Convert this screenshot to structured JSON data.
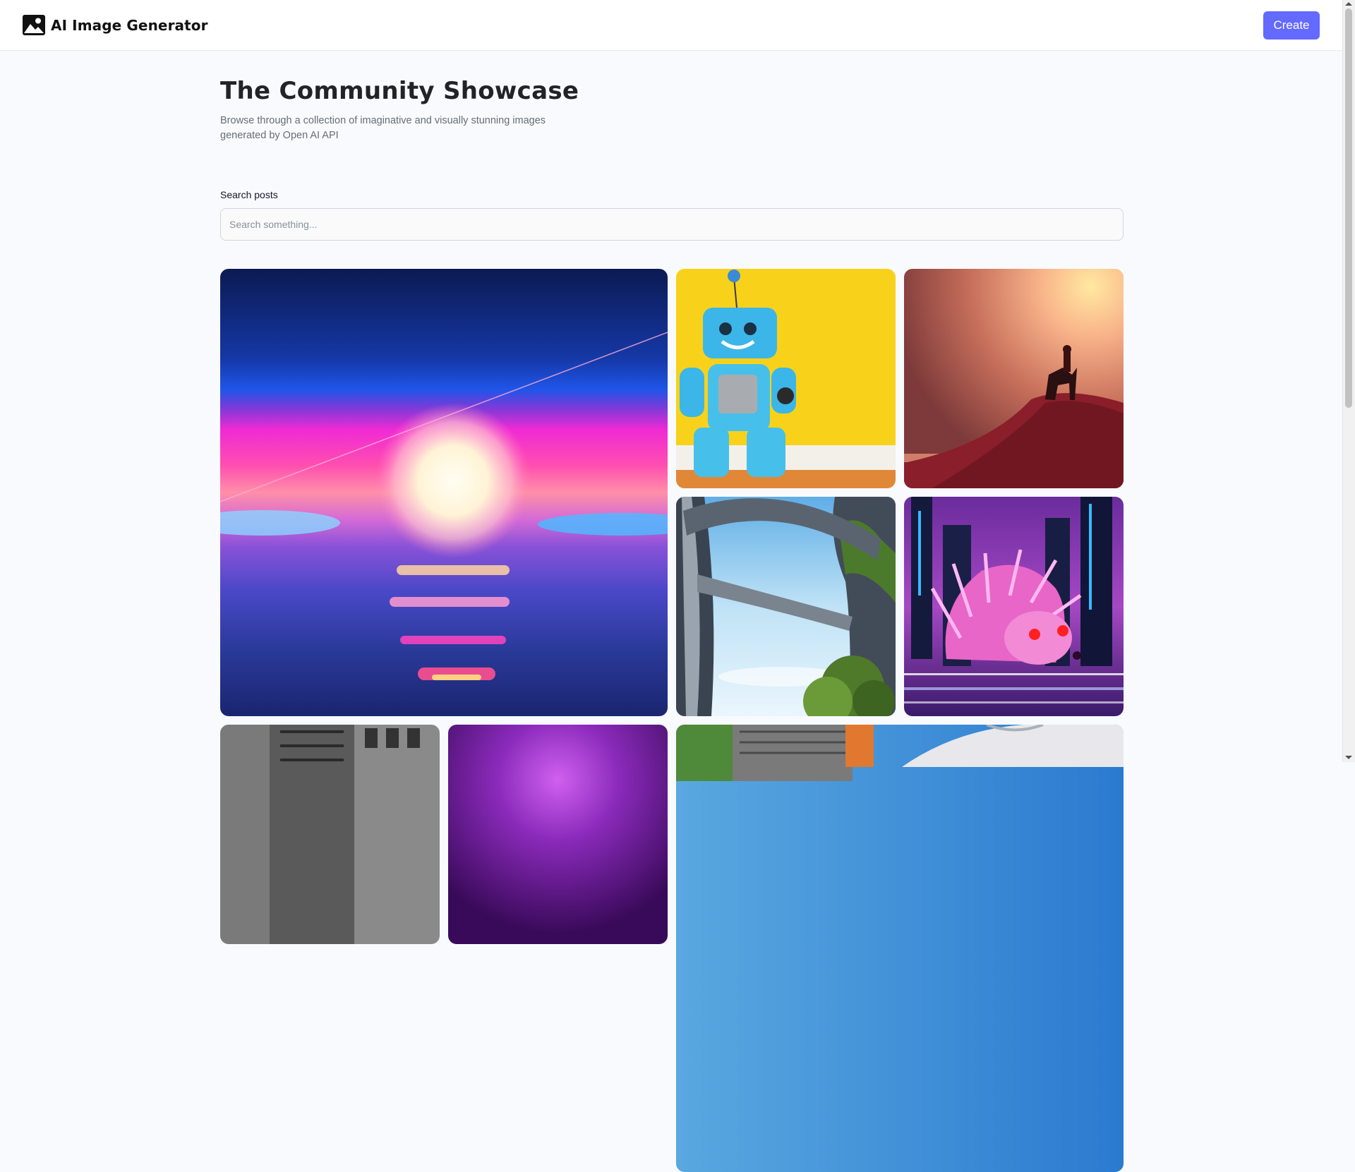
{
  "app": {
    "brand_name": "AI Image Generator",
    "brand_icon": "image-icon",
    "create_label": "Create",
    "accent_color": "#6469ff"
  },
  "hero": {
    "title": "The Community Showcase",
    "subtitle": "Browse through a collection of imaginative and visually stunning images generated by Open AI API"
  },
  "search": {
    "label": "Search posts",
    "placeholder": "Search something...",
    "value": ""
  },
  "gallery": {
    "cards": [
      {
        "subject": "neon sunset over ocean"
      },
      {
        "subject": "knitted blue robot on yellow wall"
      },
      {
        "subject": "rider on horse atop hill at hazy sunset"
      },
      {
        "subject": "futuristic overgrown towers with sky bridges"
      },
      {
        "subject": "pink cyberpunk hedgehog in neon city"
      },
      {
        "subject": "black and white city street"
      },
      {
        "subject": "purple glowing abstract"
      },
      {
        "subject": "overgrown tower and spaceship"
      }
    ]
  }
}
